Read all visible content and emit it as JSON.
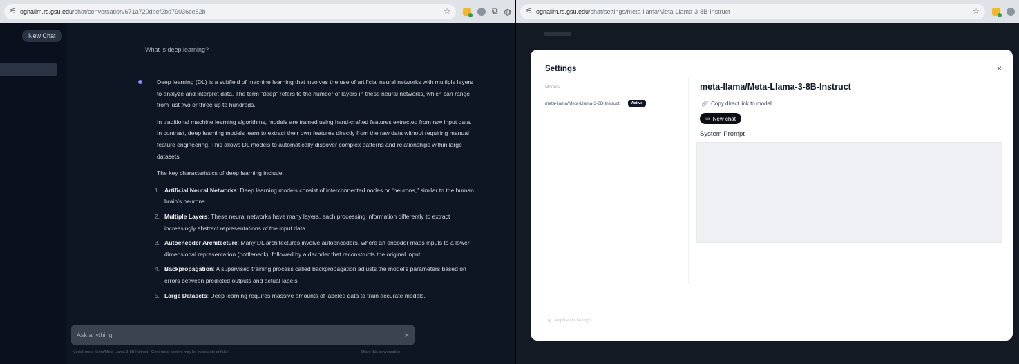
{
  "browser": {
    "left_url_host": "ognalim.rs.gsu.edu",
    "left_url_path": "/chat/conversation/671a720dbef2bd79036ce52b",
    "right_url_host": "ognalim.rs.gsu.edu",
    "right_url_path": "/chat/settings/meta-llama/Meta-Llama-3-8B-Instruct"
  },
  "sidebar": {
    "new_chat_label": "New Chat"
  },
  "chat": {
    "user_message": "What is deep learning?",
    "answer": {
      "p1": "Deep learning (DL) is a subfield of machine learning that involves the use of artificial neural networks with multiple layers to analyze and interpret data. The term \"deep\" refers to the number of layers in these neural networks, which can range from just two or three up to hundreds.",
      "p2": "In traditional machine learning algorithms, models are trained using hand-crafted features extracted from raw input data. In contrast, deep learning models learn to extract their own features directly from the raw data without requiring manual feature engineering. This allows DL models to automatically discover complex patterns and relationships within large datasets.",
      "p3": "The key characteristics of deep learning include:",
      "items": [
        {
          "num": "1.",
          "title": "Artificial Neural Networks",
          "text": ": Deep learning models consist of interconnected nodes or \"neurons,\" similar to the human brain's neurons."
        },
        {
          "num": "2.",
          "title": "Multiple Layers",
          "text": ": These neural networks have many layers, each processing information differently to extract increasingly abstract representations of the input data."
        },
        {
          "num": "3.",
          "title": "Autoencoder Architecture",
          "text": ": Many DL architectures involve autoencoders, where an encoder maps inputs to a lower-dimensional representation (bottleneck), followed by a decoder that reconstructs the original input."
        },
        {
          "num": "4.",
          "title": "Backpropagation",
          "text": ": A supervised training process called backpropagation adjusts the model's parameters based on errors between predicted outputs and actual labels."
        },
        {
          "num": "5.",
          "title": "Large Datasets",
          "text": ": Deep learning requires massive amounts of labeled data to train accurate models."
        }
      ]
    },
    "composer_placeholder": "Ask anything",
    "footer_left": "Model: meta-llama/Meta-Llama-3-8B-Instruct · Generated content may be inaccurate or false.",
    "footer_right": "Share this conversation"
  },
  "settings": {
    "title": "Settings",
    "close_glyph": "×",
    "models_label": "Models",
    "model_list": [
      {
        "name": "meta-llama/Meta-Llama-3-8B-Instruct",
        "badge": "Active"
      }
    ],
    "selected_model_title": "meta-llama/Meta-Llama-3-8B-Instruct",
    "copy_link_label": "Copy direct link to model",
    "new_chat_label": "New chat",
    "system_prompt_label": "System Prompt",
    "system_prompt_value": "",
    "app_settings_label": "Application Settings"
  },
  "icons": {
    "tune": "tune-icon",
    "star": "star-icon",
    "link": "link-icon",
    "chat": "chat-bubble-icon",
    "close": "close-icon",
    "gear": "gear-icon",
    "send": "send-icon"
  }
}
